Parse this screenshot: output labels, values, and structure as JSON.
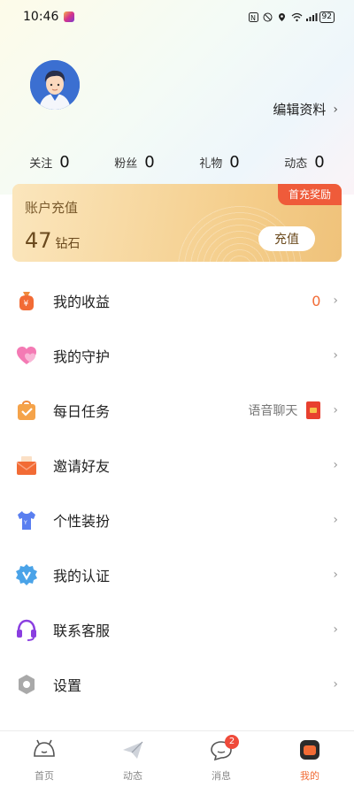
{
  "status_bar": {
    "time": "10:46",
    "battery": "92"
  },
  "profile": {
    "edit_label": "编辑资料"
  },
  "stats": [
    {
      "label": "关注",
      "value": "0"
    },
    {
      "label": "粉丝",
      "value": "0"
    },
    {
      "label": "礼物",
      "value": "0"
    },
    {
      "label": "动态",
      "value": "0"
    }
  ],
  "recharge": {
    "title": "账户充值",
    "amount": "47",
    "unit": "钻石",
    "badge": "首充奖励",
    "button": "充值"
  },
  "menu": [
    {
      "label": "我的收益",
      "icon": "money-bag-icon",
      "extra_num": "0"
    },
    {
      "label": "我的守护",
      "icon": "heart-icon"
    },
    {
      "label": "每日任务",
      "icon": "task-bag-icon",
      "extra_text": "语音聊天"
    },
    {
      "label": "邀请好友",
      "icon": "envelope-icon"
    },
    {
      "label": "个性装扮",
      "icon": "tshirt-icon"
    },
    {
      "label": "我的认证",
      "icon": "verified-badge-icon"
    },
    {
      "label": "联系客服",
      "icon": "headset-icon"
    },
    {
      "label": "设置",
      "icon": "settings-icon"
    }
  ],
  "bottom_nav": [
    {
      "label": "首页",
      "icon": "home-icon"
    },
    {
      "label": "动态",
      "icon": "paper-plane-icon"
    },
    {
      "label": "消息",
      "icon": "message-icon",
      "badge": "2"
    },
    {
      "label": "我的",
      "icon": "profile-icon",
      "active": true
    }
  ],
  "colors": {
    "accent": "#f26b35",
    "recharge_gold": "#f4cd8a",
    "badge_red": "#ef4a3a"
  }
}
